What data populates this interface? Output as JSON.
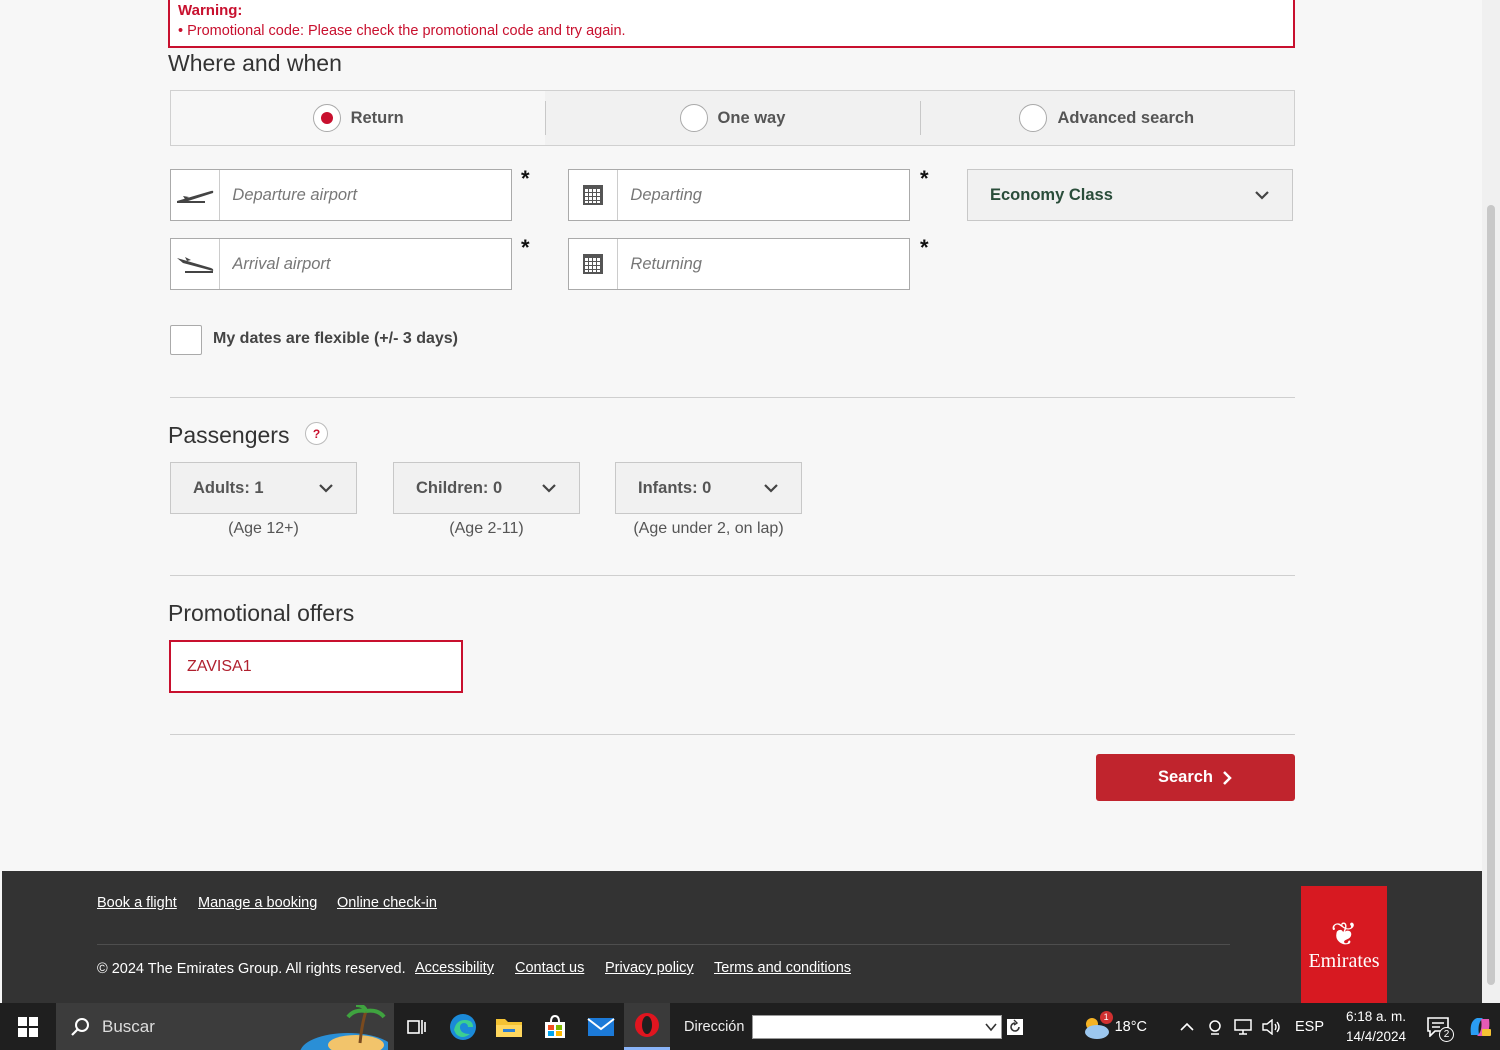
{
  "warning": {
    "title": "Warning:",
    "message": "• Promotional code: Please check the promotional code and try again."
  },
  "where_when": {
    "heading": "Where and when",
    "trip_options": [
      {
        "label": "Return",
        "selected": true
      },
      {
        "label": "One way",
        "selected": false
      },
      {
        "label": "Advanced search",
        "selected": false
      }
    ],
    "departure_airport_placeholder": "Departure airport",
    "arrival_airport_placeholder": "Arrival airport",
    "departing_placeholder": "Departing",
    "returning_placeholder": "Returning",
    "required_mark": "*",
    "cabin_class": "Economy Class",
    "flexible_label": "My dates are flexible (+/- 3 days)"
  },
  "passengers": {
    "heading": "Passengers",
    "help": "?",
    "adults": {
      "label": "Adults: 1",
      "hint": "(Age 12+)"
    },
    "children": {
      "label": "Children: 0",
      "hint": "(Age 2-11)"
    },
    "infants": {
      "label": "Infants: 0",
      "hint": "(Age under 2, on lap)"
    }
  },
  "promo": {
    "heading": "Promotional offers",
    "value": "ZAVISA1"
  },
  "search_label": "Search",
  "footer": {
    "links": [
      "Book a flight",
      "Manage a booking",
      "Online check-in"
    ],
    "copyright": "© 2024 The Emirates Group. All rights reserved.",
    "legal_links": [
      "Accessibility",
      "Contact us",
      "Privacy policy",
      "Terms and conditions"
    ],
    "logo_text": "Emirates"
  },
  "taskbar": {
    "search_text": "Buscar",
    "address_label": "Dirección",
    "weather": "18°C",
    "weather_badge": "1",
    "language": "ESP",
    "time": "6:18 a. m.",
    "date": "14/4/2024",
    "notifications": "2"
  },
  "colors": {
    "brand_red": "#c8102e",
    "footer_bg": "#333333"
  }
}
